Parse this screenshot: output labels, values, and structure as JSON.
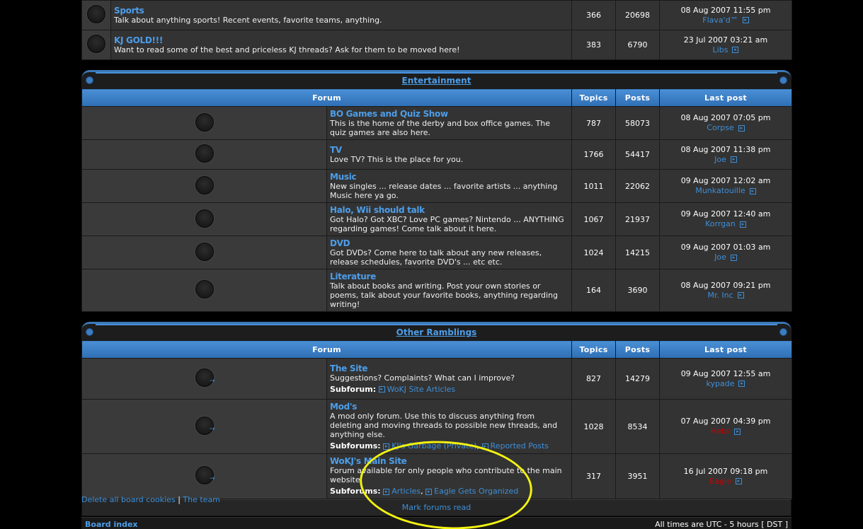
{
  "top_rows": [
    {
      "name": "Sports",
      "desc": "Talk about anything sports! Recent events, favorite teams, anything.",
      "topics": "366",
      "posts": "20698",
      "last_date": "08 Aug 2007 11:55 pm",
      "last_user": "Flava'd™"
    },
    {
      "name": "KJ GOLD!!!",
      "desc": "Want to read some of the best and priceless KJ threads? Ask for them to be moved here!",
      "topics": "383",
      "posts": "6790",
      "last_date": "23 Jul 2007 03:21 am",
      "last_user": "Libs"
    }
  ],
  "columns": {
    "forum": "Forum",
    "topics": "Topics",
    "posts": "Posts",
    "last_post": "Last post"
  },
  "entertainment": {
    "title": "Entertainment",
    "rows": [
      {
        "name": "BO Games and Quiz Show",
        "desc": "This is the home of the derby and box office games. The quiz games are also here.",
        "topics": "787",
        "posts": "58073",
        "last_date": "08 Aug 2007 07:05 pm",
        "last_user": "Corpse"
      },
      {
        "name": "TV",
        "desc": "Love TV? This is the place for you.",
        "topics": "1766",
        "posts": "54417",
        "last_date": "08 Aug 2007 11:38 pm",
        "last_user": "Joe"
      },
      {
        "name": "Music",
        "desc": "New singles ... release dates ... favorite artists ... anything Music here ya go.",
        "topics": "1011",
        "posts": "22062",
        "last_date": "09 Aug 2007 12:02 am",
        "last_user": "Munkatouille"
      },
      {
        "name": "Halo, Wii should talk",
        "desc": "Got Halo? Got XBC? Love PC games? Nintendo ... ANYTHING regarding games! Come talk about it here.",
        "topics": "1067",
        "posts": "21937",
        "last_date": "09 Aug 2007 12:40 am",
        "last_user": "Korrgan"
      },
      {
        "name": "DVD",
        "desc": "Got DVDs? Come here to talk about any new releases, release schedules, favorite DVD's ... etc etc.",
        "topics": "1024",
        "posts": "14215",
        "last_date": "09 Aug 2007 01:03 am",
        "last_user": "Joe"
      },
      {
        "name": "Literature",
        "desc": "Talk about books and writing. Post your own stories or poems, talk about your favorite books, anything regarding writing!",
        "topics": "164",
        "posts": "3690",
        "last_date": "08 Aug 2007 09:21 pm",
        "last_user": "Mr. Inc"
      }
    ]
  },
  "other": {
    "title": "Other Ramblings",
    "rows": [
      {
        "name": "The Site",
        "desc": "Suggestions? Complaints? What can I improve?",
        "sub_label": "Subforum:",
        "subs": [
          "WoKJ Site Articles"
        ],
        "topics": "827",
        "posts": "14279",
        "last_date": "09 Aug 2007 12:55 am",
        "last_user": "kypade"
      },
      {
        "name": "Mod's",
        "desc": "A mod only forum. Use this to discuss anything from deleting and moving threads to possible new threads, and anything else.",
        "sub_label": "Subforums:",
        "subs": [
          "KJ's Garbage (Private)",
          "Reported Posts"
        ],
        "topics": "1028",
        "posts": "8534",
        "last_date": "07 Aug 2007 04:39 pm",
        "last_user": "Hebs"
      },
      {
        "name": "WoKJ's Main Site",
        "desc": "Forum available for only people who contribute to the main website",
        "sub_label": "Subforums:",
        "subs": [
          "Articles",
          "Eagle Gets Organized"
        ],
        "topics": "317",
        "posts": "3951",
        "last_date": "16 Jul 2007 09:18 pm",
        "last_user": "Eagle"
      }
    ]
  },
  "mark_read": "Mark forums read",
  "links": {
    "delete_cookies": "Delete all board cookies",
    "separator": "|",
    "team": "The team"
  },
  "footer": {
    "board_index": "Board index",
    "timezone": "All times are UTC - 5 hours [ DST ]"
  },
  "colors": {
    "accent": "#4d9eea",
    "red_user": "#cc0000",
    "annotation": "#f2f210"
  }
}
